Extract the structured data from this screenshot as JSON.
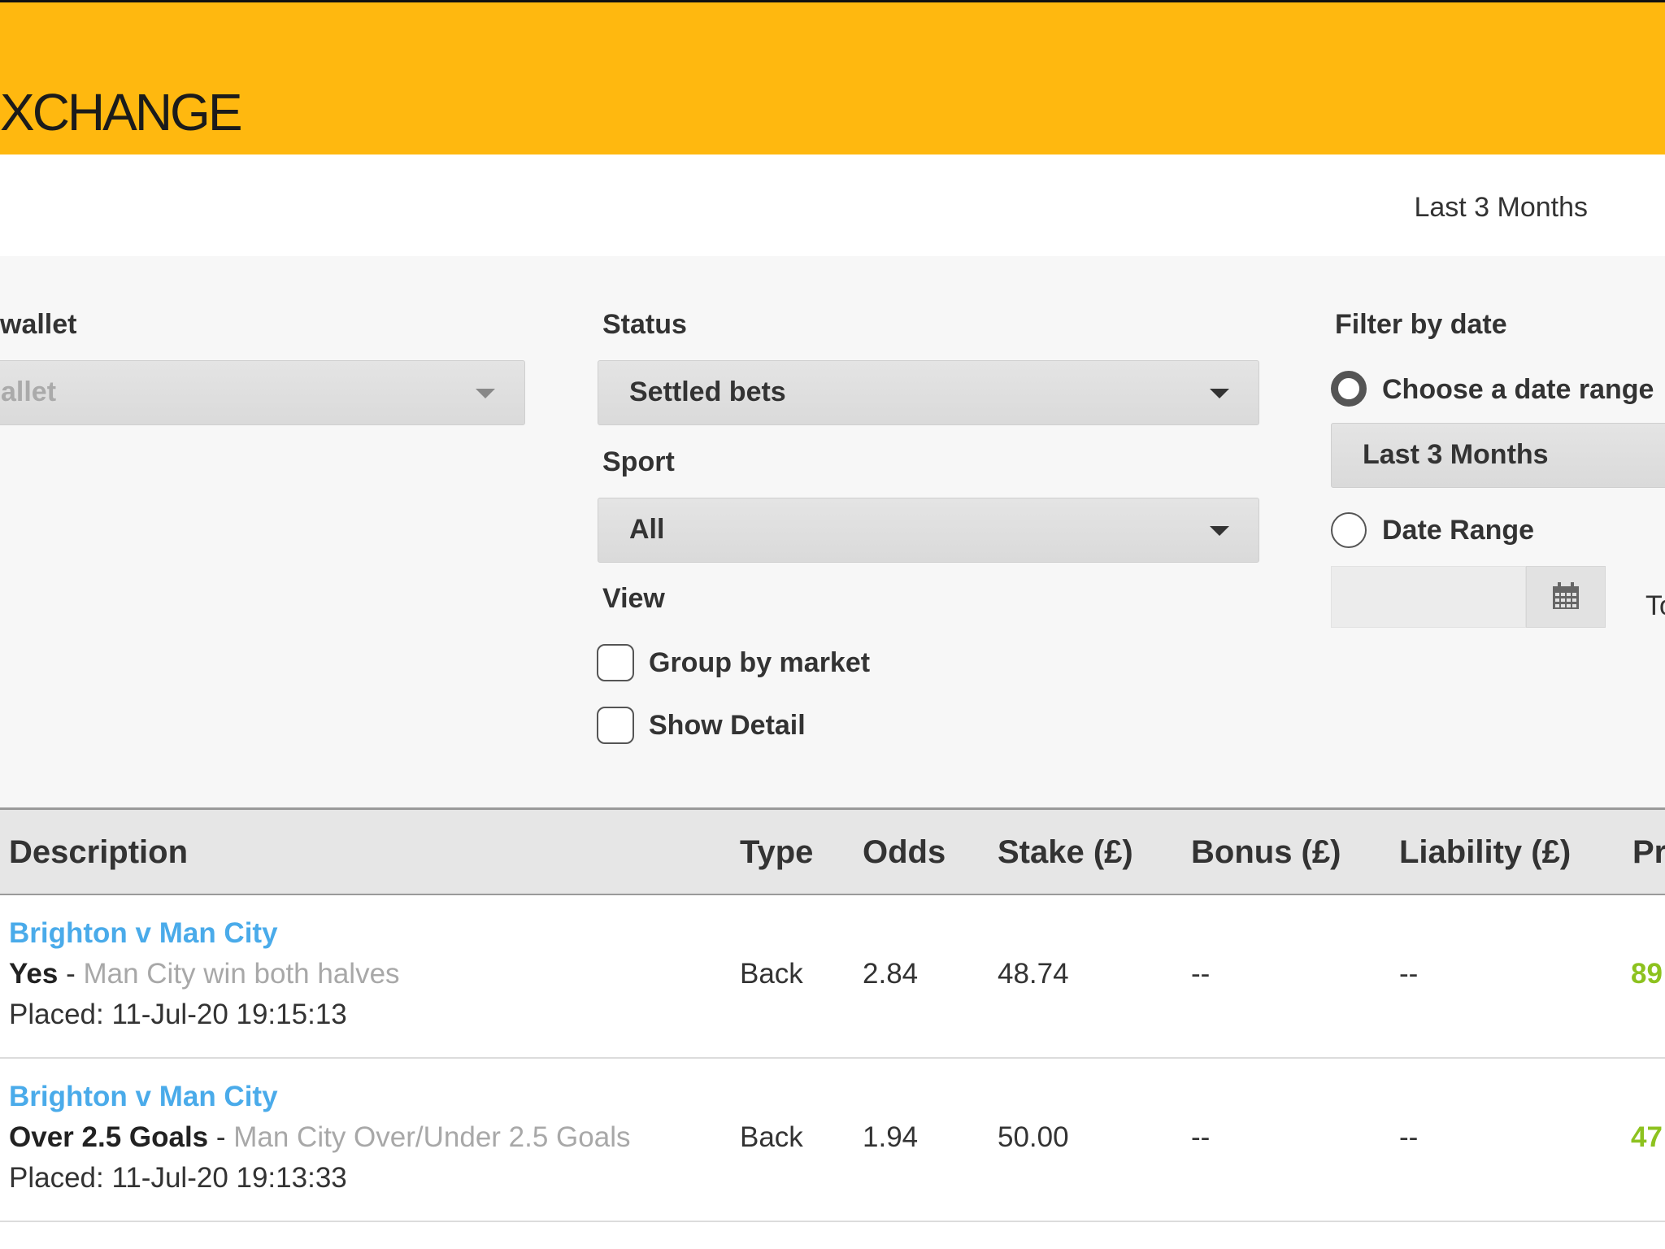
{
  "header": {
    "brand": "XCHANGE"
  },
  "period": {
    "label": "Last 3 Months"
  },
  "filters": {
    "wallet": {
      "label": "wallet",
      "value": "allet"
    },
    "status": {
      "label": "Status",
      "value": "Settled bets"
    },
    "sport": {
      "label": "Sport",
      "value": "All"
    },
    "view": {
      "label": "View",
      "options": [
        {
          "label": "Group by market",
          "checked": false
        },
        {
          "label": "Show Detail",
          "checked": false
        }
      ]
    },
    "date": {
      "label": "Filter by date",
      "choose_range_label": "Choose a date range",
      "choose_range_checked": true,
      "range_value": "Last 3 Months",
      "date_range_label": "Date Range",
      "date_range_checked": false,
      "from_value": "",
      "to_label": "To"
    }
  },
  "table": {
    "columns": [
      "Description",
      "Type",
      "Odds",
      "Stake (£)",
      "Bonus (£)",
      "Liability (£)",
      "Pr"
    ],
    "rows": [
      {
        "event": "Brighton v Man City",
        "selection": "Yes",
        "separator": " - ",
        "market": "Man City win both halves",
        "placed": "Placed: 11-Jul-20 19:15:13",
        "type": "Back",
        "odds": "2.84",
        "stake": "48.74",
        "bonus": "--",
        "liability": "--",
        "profit": "89"
      },
      {
        "event": "Brighton v Man City",
        "selection": "Over 2.5 Goals",
        "separator": " - ",
        "market": "Man City Over/Under 2.5 Goals",
        "placed": "Placed: 11-Jul-20 19:13:33",
        "type": "Back",
        "odds": "1.94",
        "stake": "50.00",
        "bonus": "--",
        "liability": "--",
        "profit": "47"
      }
    ]
  },
  "colors": {
    "header_bg": "#FFB80F",
    "link": "#4AABEA",
    "profit": "#8DC21F"
  }
}
